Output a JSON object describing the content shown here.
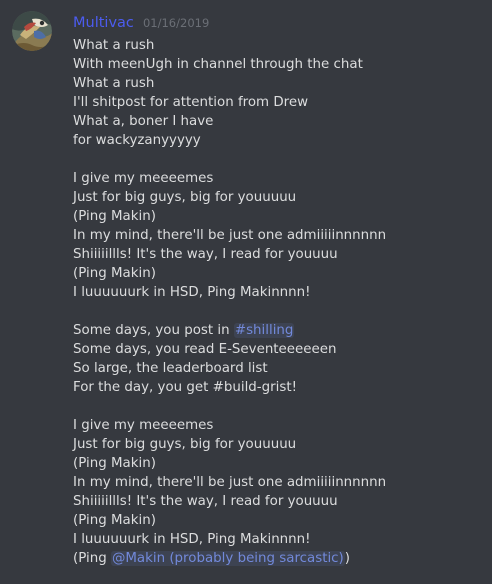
{
  "message": {
    "username": "Multivac",
    "timestamp": "01/16/2019",
    "username_color": "#4c5cf0",
    "avatar_icon": "avatar-image",
    "lines": [
      {
        "text": "What a rush"
      },
      {
        "text": "With meenUgh in channel through the chat"
      },
      {
        "text": "What a rush"
      },
      {
        "text": "I'll shitpost for attention from Drew"
      },
      {
        "text": "What a, boner I have"
      },
      {
        "text": "for wackyzanyyyyy"
      },
      {
        "blank": true
      },
      {
        "text": "I give my meeeemes"
      },
      {
        "text": "Just for big guys, big for youuuuu"
      },
      {
        "text": "(Ping Makin)"
      },
      {
        "text": "In my mind, there'll be just one admiiiiinnnnnn"
      },
      {
        "text": "Shiiiiillls! It's the way, I read for youuuu"
      },
      {
        "text": "(Ping Makin)"
      },
      {
        "text": "I luuuuuurk in HSD, Ping Makinnnn!"
      },
      {
        "blank": true
      },
      {
        "pre": "Some days, you post in ",
        "channel": "#shilling",
        "post": ""
      },
      {
        "text": "Some days, you read E-Seventeeeeeen"
      },
      {
        "text": "So large, the leaderboard list"
      },
      {
        "text": "For the day, you get #build-grist!"
      },
      {
        "blank": true
      },
      {
        "text": "I give my meeeemes"
      },
      {
        "text": "Just for big guys, big for youuuuu"
      },
      {
        "text": "(Ping Makin)"
      },
      {
        "text": "In my mind, there'll be just one admiiiiinnnnnn"
      },
      {
        "text": "Shiiiiillls! It's the way, I read for youuuu"
      },
      {
        "text": "(Ping Makin)"
      },
      {
        "text": "I luuuuuurk in HSD, Ping Makinnnn!"
      },
      {
        "pre": "(Ping ",
        "mention": "@Makin (probably being sarcastic)",
        "post": ")"
      }
    ]
  }
}
